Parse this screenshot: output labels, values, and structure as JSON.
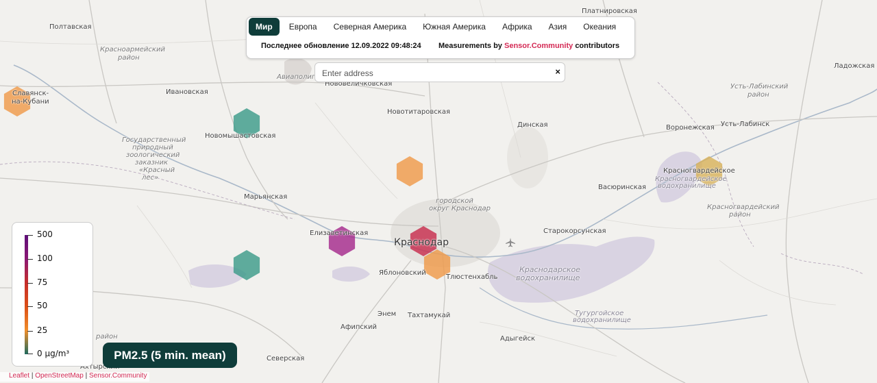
{
  "tabs": [
    {
      "label": "Мир",
      "active": true
    },
    {
      "label": "Европа"
    },
    {
      "label": "Северная Америка"
    },
    {
      "label": "Южная Америка"
    },
    {
      "label": "Африка"
    },
    {
      "label": "Азия"
    },
    {
      "label": "Океания"
    }
  ],
  "update": {
    "last_update": "Последнее обновление 12.09.2022 09:48:24",
    "measurements_prefix": "Measurements by",
    "source": "Sensor.Community",
    "measurements_suffix": "contributors"
  },
  "search": {
    "placeholder": "Enter address",
    "clear_label": "×"
  },
  "legend": {
    "labels": [
      "500",
      "100",
      "75",
      "50",
      "25",
      "0 µg/m³"
    ],
    "colors": {
      "top": "#5e0f78",
      "mid": "#c62d2a",
      "low": "#ef8d2a",
      "zero": "#1f6b5e"
    }
  },
  "pm_button": {
    "label": "PM2.5 (5 min. mean)"
  },
  "attribution": {
    "leaflet": "Leaflet",
    "osm": "OpenStreetMap",
    "sc": "Sensor.Community",
    "sep": "|"
  },
  "map_labels": {
    "poltavskaya": "Полтавская",
    "krasnoarm_1": "Красноармейский",
    "krasnoarm_2": "район",
    "aviapolygon": "Авиаполигон",
    "novovelichk": "Нововеличковская",
    "platnirovskaya": "Платнировская",
    "ladozhskaya": "Ладожская",
    "ust_lab_r1": "Усть-Лабинский",
    "ust_lab_r2": "район",
    "slavyansk_1": "Славянск-",
    "slavyansk_2": "на-Кубани",
    "ivanovskaya": "Ивановская",
    "novotitar": "Новотитаровская",
    "dinskaya": "Динская",
    "voronezhskaya": "Воронежская",
    "ust_labinsk": "Усть-Лабинск",
    "novomysh": "Новомышастовская",
    "zapoved_1": "Государственный",
    "zapoved_2": "природный",
    "zapoved_3": "зоологический",
    "zapoved_4": "заказник",
    "zapoved_5": "«Красный",
    "zapoved_6": "лес»",
    "krasnogv": "Красногвардейское",
    "krasnogv_res_1": "Красногвардейское",
    "krasnogv_res_2": "водохранилище",
    "vasyurinskaya": "Васюринская",
    "maryanskaya": "Марьянская",
    "gorokrug_1": "городской",
    "gorokrug_2": "округ Краснодар",
    "krasnogv_r1": "Красногвардейский",
    "krasnogv_r2": "район",
    "starokorsun": "Старокорсунская",
    "elizavetinsk": "Елизаветинская",
    "krasnodar": "Краснодар",
    "yablonovsky": "Яблоновский",
    "tlyustenkhabl": "Тлюстенхабль",
    "krd_res_1": "Краснодарское",
    "krd_res_2": "водохранилище",
    "tugurgoy_1": "Тугургойское",
    "tugurgoy_2": "водохранилище",
    "enem": "Энем",
    "takhtamukay": "Тахтамукай",
    "afipsky": "Афипский",
    "adygeysk": "Адыгейск",
    "severskaya": "Северская",
    "district_frag": "район",
    "akhtyrsky": "Ахтырский"
  },
  "sensors": [
    {
      "value": 30,
      "color": "#ef9a4a"
    },
    {
      "value": 5,
      "color": "#3d9b8a"
    },
    {
      "value": 30,
      "color": "#ef9a4a"
    },
    {
      "value": 20,
      "color": "#d8b25c"
    },
    {
      "value": 120,
      "color": "#a52a8c"
    },
    {
      "value": 80,
      "color": "#c82d4e"
    },
    {
      "value": 30,
      "color": "#ef9a4a"
    },
    {
      "value": 5,
      "color": "#3d9b8a"
    }
  ]
}
